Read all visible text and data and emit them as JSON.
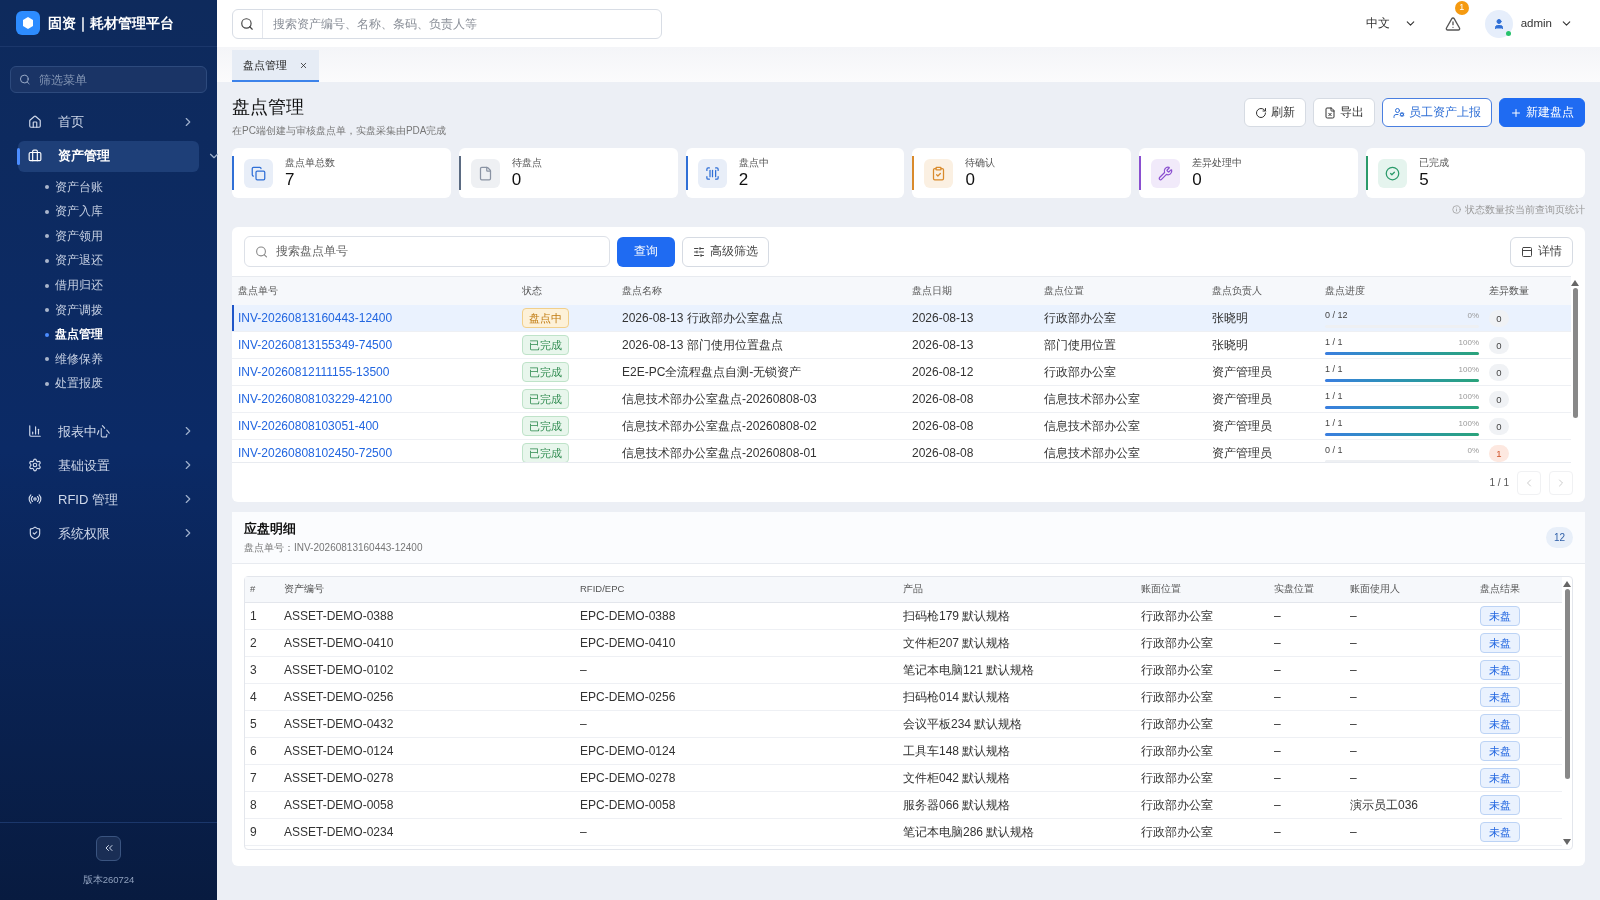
{
  "sidebar": {
    "logo_title": "固资｜耗材管理平台",
    "filter_placeholder": "筛选菜单",
    "items": [
      {
        "label": "首页",
        "selected": false,
        "expanded": false
      },
      {
        "label": "资产管理",
        "selected": true,
        "expanded": true,
        "children": [
          {
            "label": "资产台账",
            "selected": false
          },
          {
            "label": "资产入库",
            "selected": false
          },
          {
            "label": "资产领用",
            "selected": false
          },
          {
            "label": "资产退还",
            "selected": false
          },
          {
            "label": "借用归还",
            "selected": false
          },
          {
            "label": "资产调拨",
            "selected": false
          },
          {
            "label": "盘点管理",
            "selected": true
          },
          {
            "label": "维修保养",
            "selected": false
          },
          {
            "label": "处置报废",
            "selected": false
          }
        ]
      },
      {
        "label": "报表中心",
        "selected": false,
        "expanded": false
      },
      {
        "label": "基础设置",
        "selected": false,
        "expanded": false
      },
      {
        "label": "RFID 管理",
        "selected": false,
        "expanded": false
      },
      {
        "label": "系统权限",
        "selected": false,
        "expanded": false
      }
    ],
    "version": "版本260724"
  },
  "header": {
    "search_placeholder": "搜索资产编号、名称、条码、负责人等",
    "language": "中文",
    "alert_count": "1",
    "user": "admin"
  },
  "tabs": [
    {
      "label": "盘点管理",
      "selected": true
    }
  ],
  "page": {
    "title": "盘点管理",
    "subtitle": "在PC端创建与审核盘点单，实盘采集由PDA完成",
    "buttons": [
      {
        "label": "刷新",
        "kind": "refresh"
      },
      {
        "label": "导出",
        "kind": "export"
      },
      {
        "label": "员工资产上报",
        "kind": "report"
      },
      {
        "label": "新建盘点",
        "kind": "primary"
      }
    ]
  },
  "stats": [
    {
      "label": "盘点单总数",
      "value": "7",
      "kind": "total",
      "color": "#2f6fd6"
    },
    {
      "label": "待盘点",
      "value": "0",
      "kind": "pending",
      "color": "#5b6b82"
    },
    {
      "label": "盘点中",
      "value": "2",
      "kind": "active",
      "color": "#2f6fd6"
    },
    {
      "label": "待确认",
      "value": "0",
      "kind": "confirm",
      "color": "#d98a2b"
    },
    {
      "label": "差异处理中",
      "value": "0",
      "kind": "diff",
      "color": "#8a4fd0"
    },
    {
      "label": "已完成",
      "value": "5",
      "kind": "done",
      "color": "#2a9a6a"
    }
  ],
  "stats_note": "状态数量按当前查询页统计",
  "orders": {
    "search_placeholder": "搜索盘点单号",
    "query_button": "查询",
    "filter_button": "高级筛选",
    "detail_button": "详情",
    "columns": [
      "盘点单号",
      "状态",
      "盘点名称",
      "盘点日期",
      "盘点位置",
      "盘点负责人",
      "盘点进度",
      "差异数量"
    ],
    "rows": [
      {
        "id": "INV-20260813160443-12400",
        "status": "盘点中",
        "kind": "active",
        "name": "2026-08-13 行政部办公室盘点",
        "date": "2026-08-13",
        "location": "行政部办公室",
        "owner": "张晓明",
        "progress": "0 / 12",
        "percent": "0%",
        "level": 0,
        "diff": "0",
        "diff_alert": false,
        "selected": true
      },
      {
        "id": "INV-20260813155349-74500",
        "status": "已完成",
        "kind": "done",
        "name": "2026-08-13 部门使用位置盘点",
        "date": "2026-08-13",
        "location": "部门使用位置",
        "owner": "张晓明",
        "progress": "1 / 1",
        "percent": "100%",
        "level": 1,
        "diff": "0",
        "diff_alert": false,
        "selected": false
      },
      {
        "id": "INV-20260812111155-13500",
        "status": "已完成",
        "kind": "done",
        "name": "E2E-PC全流程盘点自测-无锁资产",
        "date": "2026-08-12",
        "location": "行政部办公室",
        "owner": "资产管理员",
        "progress": "1 / 1",
        "percent": "100%",
        "level": 1,
        "diff": "0",
        "diff_alert": false,
        "selected": false
      },
      {
        "id": "INV-20260808103229-42100",
        "status": "已完成",
        "kind": "done",
        "name": "信息技术部办公室盘点-20260808-03",
        "date": "2026-08-08",
        "location": "信息技术部办公室",
        "owner": "资产管理员",
        "progress": "1 / 1",
        "percent": "100%",
        "level": 1,
        "diff": "0",
        "diff_alert": false,
        "selected": false
      },
      {
        "id": "INV-20260808103051-400",
        "status": "已完成",
        "kind": "done",
        "name": "信息技术部办公室盘点-20260808-02",
        "date": "2026-08-08",
        "location": "信息技术部办公室",
        "owner": "资产管理员",
        "progress": "1 / 1",
        "percent": "100%",
        "level": 1,
        "diff": "0",
        "diff_alert": false,
        "selected": false
      },
      {
        "id": "INV-20260808102450-72500",
        "status": "已完成",
        "kind": "done",
        "name": "信息技术部办公室盘点-20260808-01",
        "date": "2026-08-08",
        "location": "信息技术部办公室",
        "owner": "资产管理员",
        "progress": "0 / 1",
        "percent": "0%",
        "level": 0,
        "diff": "1",
        "diff_alert": true,
        "selected": false
      }
    ],
    "pager": "1 / 1"
  },
  "detail": {
    "title": "应盘明细",
    "subtitle": "盘点单号：INV-20260813160443-12400",
    "count": "12",
    "columns": [
      "#",
      "资产编号",
      "RFID/EPC",
      "产品",
      "账面位置",
      "实盘位置",
      "账面使用人",
      "盘点结果"
    ],
    "rows": [
      [
        "1",
        "ASSET-DEMO-0388",
        "EPC-DEMO-0388",
        "扫码枪179 默认规格",
        "行政部办公室",
        "–",
        "–",
        "未盘"
      ],
      [
        "2",
        "ASSET-DEMO-0410",
        "EPC-DEMO-0410",
        "文件柜207 默认规格",
        "行政部办公室",
        "–",
        "–",
        "未盘"
      ],
      [
        "3",
        "ASSET-DEMO-0102",
        "–",
        "笔记本电脑121 默认规格",
        "行政部办公室",
        "–",
        "–",
        "未盘"
      ],
      [
        "4",
        "ASSET-DEMO-0256",
        "EPC-DEMO-0256",
        "扫码枪014 默认规格",
        "行政部办公室",
        "–",
        "–",
        "未盘"
      ],
      [
        "5",
        "ASSET-DEMO-0432",
        "–",
        "会议平板234 默认规格",
        "行政部办公室",
        "–",
        "–",
        "未盘"
      ],
      [
        "6",
        "ASSET-DEMO-0124",
        "EPC-DEMO-0124",
        "工具车148 默认规格",
        "行政部办公室",
        "–",
        "–",
        "未盘"
      ],
      [
        "7",
        "ASSET-DEMO-0278",
        "EPC-DEMO-0278",
        "文件柜042 默认规格",
        "行政部办公室",
        "–",
        "–",
        "未盘"
      ],
      [
        "8",
        "ASSET-DEMO-0058",
        "EPC-DEMO-0058",
        "服务器066 默认规格",
        "行政部办公室",
        "–",
        "演示员工036",
        "未盘"
      ],
      [
        "9",
        "ASSET-DEMO-0234",
        "–",
        "笔记本电脑286 默认规格",
        "行政部办公室",
        "–",
        "–",
        "未盘"
      ]
    ]
  }
}
